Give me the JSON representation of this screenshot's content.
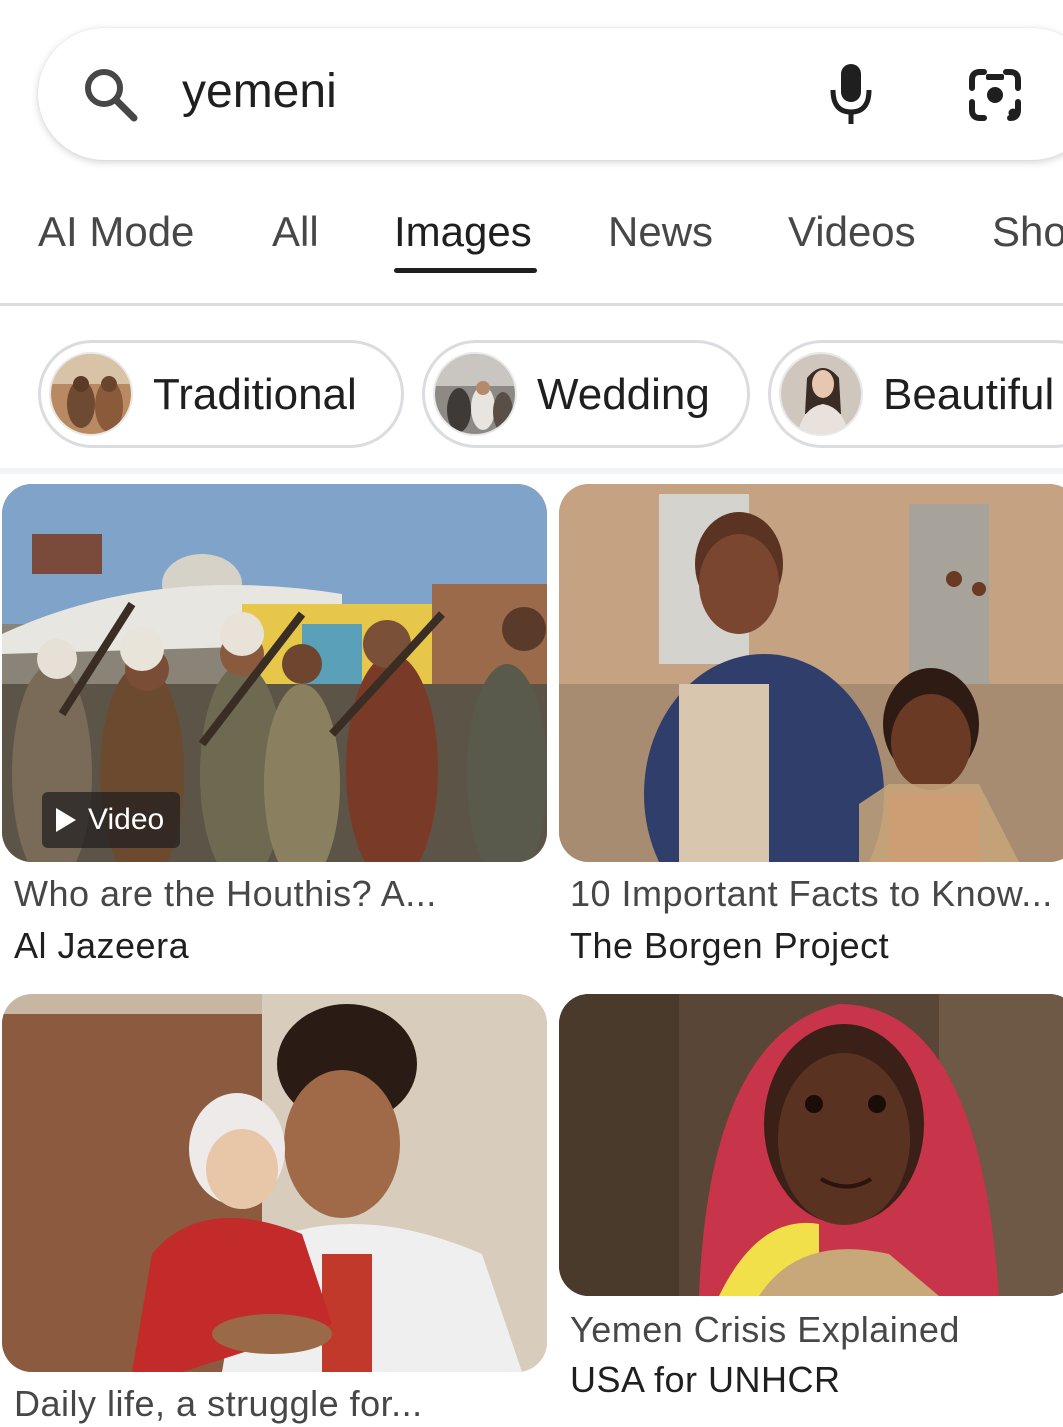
{
  "search": {
    "query": "yemeni"
  },
  "tabs": [
    {
      "label": "AI Mode"
    },
    {
      "label": "All"
    },
    {
      "label": "Images",
      "active": true
    },
    {
      "label": "News"
    },
    {
      "label": "Videos"
    },
    {
      "label": "Sho"
    }
  ],
  "chips": [
    {
      "label": "Traditional"
    },
    {
      "label": "Wedding"
    },
    {
      "label": "Beautiful"
    }
  ],
  "results": [
    {
      "title": "Who are the Houthis? A...",
      "source": "Al Jazeera",
      "badge": "Video"
    },
    {
      "title": "10 Important Facts to Know...",
      "source": "The Borgen Project"
    },
    {
      "title": "Daily life, a struggle for...",
      "source": ""
    },
    {
      "title": "Yemen Crisis Explained",
      "source": "USA for UNHCR"
    }
  ],
  "colors": {
    "text_primary": "#1f1f1f",
    "text_secondary": "#474747",
    "divider": "#dadce0"
  },
  "icons": [
    "search-icon",
    "mic-icon",
    "google-lens-icon",
    "play-icon"
  ]
}
